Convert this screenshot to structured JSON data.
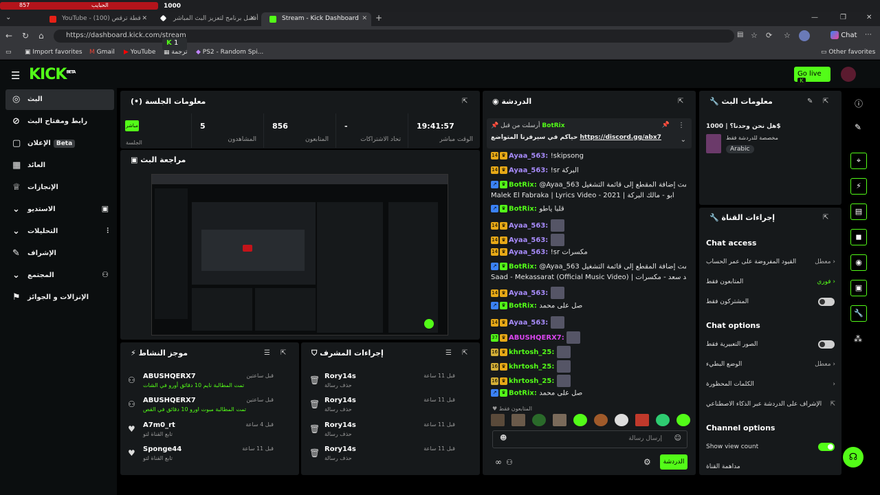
{
  "browser": {
    "top_strip": {
      "left_count": "857",
      "channel": "الحبايب",
      "right_count": "1000"
    },
    "tabs": [
      {
        "label": "YouTube - قطة ترقص (100)"
      },
      {
        "label": "أفضل برنامج لتعزيز البث المباشر"
      },
      {
        "label": "Stream - Kick Dashboard"
      }
    ],
    "url": "https://dashboard.kick.com/stream",
    "chat_button": "Chat",
    "bookmarks": [
      "Import favorites",
      "Gmail",
      "YouTube",
      "ترجمة",
      "PS2 - Random Spi..."
    ],
    "other_favorites": "Other favorites",
    "kick_tab_badge": "1"
  },
  "header": {
    "logo": "KICK",
    "logo_beta": "BETA",
    "go_live": "Go live"
  },
  "sidebar": {
    "items": [
      {
        "label": "البث",
        "icon": "broadcast-icon"
      },
      {
        "label": "رابط ومفتاح البث",
        "icon": "link-icon"
      },
      {
        "label": "الإعلان",
        "badge": "Beta",
        "icon": "ad-icon"
      },
      {
        "label": "العائد",
        "icon": "revenue-icon"
      },
      {
        "label": "الإنجازات",
        "icon": "trophy-icon"
      },
      {
        "label": "الاستديو",
        "icon": "studio-icon"
      },
      {
        "label": "التحليلات",
        "icon": "analytics-icon"
      },
      {
        "label": "الإشراف",
        "icon": "moderation-icon"
      },
      {
        "label": "المجتمع",
        "icon": "community-icon"
      },
      {
        "label": "الإنزالات و الجوائز",
        "icon": "drops-icon"
      }
    ]
  },
  "session": {
    "title": "معلومات الجلسة",
    "live_tag": "مباشر",
    "live_label": "الجلسة",
    "stats": [
      {
        "value": "5",
        "label": "المشاهدون"
      },
      {
        "value": "856",
        "label": "المتابعون"
      },
      {
        "value": "-",
        "label": "تحاد الاشتراكات"
      },
      {
        "value": "19:41:57",
        "label": "الوقت مباشر"
      }
    ]
  },
  "review": {
    "title": "مراجعة البث"
  },
  "activity": {
    "title": "موجز النشاط",
    "items": [
      {
        "name": "ABUSHQERX7",
        "desc": "تمت المطالبة نايم 10 دقائق أورو في الشات",
        "time": "قبل ساعتين"
      },
      {
        "name": "ABUSHQERX7",
        "desc": "تمت المطالبة مبوت اورو 10 دقائق في القص",
        "time": "قبل ساعتين"
      },
      {
        "name": "A7m0_rt",
        "desc": "تابع القناة لتو",
        "time": "قبل 4 ساعة"
      },
      {
        "name": "Sponge44",
        "desc": "تابع القناة لتو",
        "time": "قبل 11 ساعة"
      }
    ]
  },
  "moderator": {
    "title": "إجراءات المشرف",
    "items": [
      {
        "name": "Rory14s",
        "desc": "حذف رسالة",
        "time": "قبل 11 ساعة"
      },
      {
        "name": "Rory14s",
        "desc": "حذف رسالة",
        "time": "قبل 11 ساعة"
      },
      {
        "name": "Rory14s",
        "desc": "حذف رسالة",
        "time": "قبل 11 ساعة"
      },
      {
        "name": "Rory14s",
        "desc": "حذف رسالة",
        "time": "قبل 11 ساعة"
      }
    ]
  },
  "chat": {
    "title": "الدردشة",
    "pinned": {
      "by_label": "أرسلت من قبل",
      "user": "BotRix",
      "text": "حياكم في سيرفرنا المتواضع",
      "link": "https://discord.gg/abx7"
    },
    "messages": [
      {
        "badge": "14",
        "user": "Ayaa_563",
        "text": "!skipsong",
        "color": "#a78bfa"
      },
      {
        "badge": "14",
        "user": "Ayaa_563",
        "text": "!sr البركة",
        "color": "#a78bfa"
      },
      {
        "badge": "bot",
        "user": "BotRix",
        "text": "@Ayaa_563 تمت إضافة المقطع إلى قائمة التشغيل: Abu -",
        "color": "#53fc18"
      },
      {
        "badge": "",
        "user": "",
        "text": "Malek El Fabraka | Lyrics Video - 2021 | ابو - مالك البركة",
        "color": ""
      },
      {
        "badge": "bot",
        "user": "BotRix",
        "text": "قلبا ياطو",
        "color": "#53fc18"
      },
      {
        "badge": "14",
        "user": "Ayaa_563",
        "text": "",
        "color": "#a78bfa"
      },
      {
        "badge": "14",
        "user": "Ayaa_563",
        "text": "",
        "color": "#a78bfa"
      },
      {
        "badge": "14",
        "user": "Ayaa_563",
        "text": "!sr مكسرات",
        "color": "#a78bfa"
      },
      {
        "badge": "bot",
        "user": "BotRix",
        "text": "@Ayaa_563 تمت إضافة المقطع إلى قائمة التشغيل: Ahmed",
        "color": "#53fc18"
      },
      {
        "badge": "",
        "user": "",
        "text": "Saad - Mekassarat (Official Music Video) | أحمد سعد - مكسرات",
        "color": ""
      },
      {
        "badge": "14",
        "user": "Ayaa_563",
        "text": "",
        "color": "#a78bfa"
      },
      {
        "badge": "bot",
        "user": "BotRix",
        "text": "صل على محمد",
        "color": "#53fc18"
      },
      {
        "badge": "14",
        "user": "Ayaa_563",
        "text": "",
        "color": "#a78bfa"
      },
      {
        "badge": "37",
        "user": "ABUSHQERX7",
        "text": "",
        "color": "#d946ef"
      },
      {
        "badge": "16",
        "user": "khrtosh_25",
        "text": "",
        "color": "#53fc18"
      },
      {
        "badge": "16",
        "user": "khrtosh_25",
        "text": "",
        "color": "#53fc18"
      },
      {
        "badge": "16",
        "user": "khrtosh_25",
        "text": "",
        "color": "#53fc18"
      },
      {
        "badge": "bot",
        "user": "BotRix",
        "text": "صل على محمد",
        "color": "#53fc18"
      }
    ],
    "followers_only": "المتابعون فقط",
    "input_placeholder": "إرسال رسالة",
    "send_button": "الدردشة"
  },
  "stream_info": {
    "title": "معلومات البث",
    "stream_title": "هل نحن وحدنا؟ | 1000$",
    "category": "مخصصة للدردشة فقط",
    "language": "Arabic"
  },
  "channel_actions": {
    "title": "إجراءات القناة",
    "chat_access": "Chat access",
    "account_age": "القيود المفروضة على عمر الحساب",
    "account_age_value": "معطل",
    "followers_only": "المتابعون فقط",
    "followers_only_value": "فوري",
    "subscribers_only": "المشتركون فقط",
    "chat_options": "Chat options",
    "emotes_only": "الصور التعبيرية فقط",
    "slow_mode": "الوضع البطيء",
    "slow_mode_value": "معطل",
    "banned_words": "الكلمات المحظورة",
    "ai_moderation": "الإشراف على الدردشة عبر الذكاء الاصطناعي",
    "channel_options": "Channel options",
    "show_view_count": "Show view count",
    "channel_watch": "مداهمة القناة"
  },
  "colors": {
    "accent": "#53fc18",
    "bg": "#0b0e0f",
    "panel": "#16191b"
  }
}
